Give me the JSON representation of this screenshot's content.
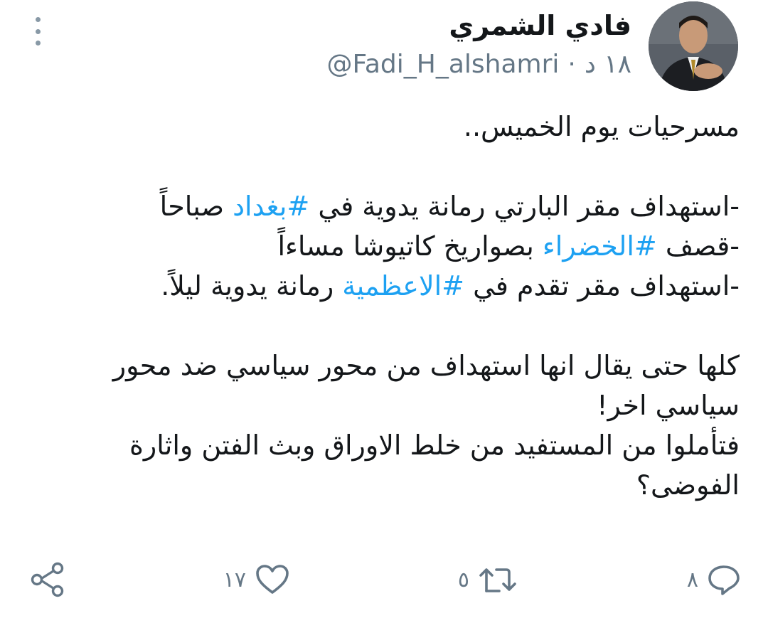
{
  "user": {
    "display_name": "فادي الشمري",
    "handle": "@Fadi_H_alshamri",
    "separator": "·",
    "time": "١٨ د"
  },
  "tweet": {
    "line1": "مسرحيات يوم الخميس..",
    "line2_prefix": "-استهداف  مقر البارتي رمانة يدوية في ",
    "line2_hashtag": "#بغداد",
    "line2_suffix": " صباحاً",
    "line3_prefix": "-قصف ",
    "line3_hashtag": "#الخضراء",
    "line3_suffix": " بصواريخ كاتيوشا مساءاً",
    "line4_prefix": "-استهداف مقر تقدم في ",
    "line4_hashtag": "#الاعظمية",
    "line4_suffix": " رمانة يدوية ليلاً.",
    "para2": "كلها حتى يقال انها استهداف من محور سياسي ضد محور سياسي اخر!",
    "para3": "فتأملوا من المستفيد من خلط الاوراق وبث الفتن واثارة الفوضى؟"
  },
  "actions": {
    "reply_count": "٨",
    "retweet_count": "٥",
    "like_count": "١٧"
  },
  "icons": {
    "more": "more-vertical-icon",
    "reply": "reply-icon",
    "retweet": "retweet-icon",
    "like": "heart-icon",
    "share": "share-icon"
  },
  "colors": {
    "hashtag": "#1da1f2",
    "text": "#14171a",
    "secondary": "#657786"
  }
}
